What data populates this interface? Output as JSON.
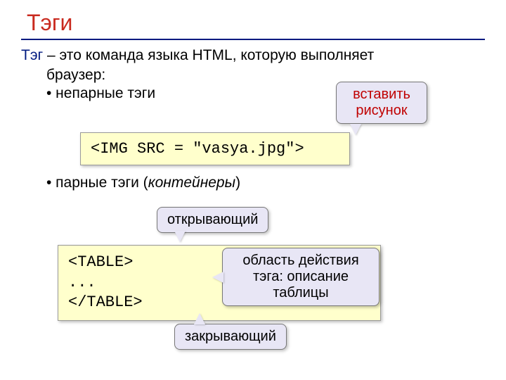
{
  "title": "Тэги",
  "definition": {
    "term": "Тэг",
    "rest_line1": " – это команда языка HTML, которую выполняет",
    "line2": "браузер:"
  },
  "bullets": {
    "b1": "• непарные тэги",
    "b2_pre": "• парные тэги (",
    "b2_it": "контейнеры",
    "b2_post": ")"
  },
  "code1": "<IMG SRC = \"vasya.jpg\">",
  "code2": "<TABLE>\n...\n</TABLE>",
  "callouts": {
    "insert_image": "вставить\nрисунок",
    "opening": "открывающий",
    "scope": "область действия\nтэга: описание\nтаблицы",
    "closing": "закрывающий"
  }
}
